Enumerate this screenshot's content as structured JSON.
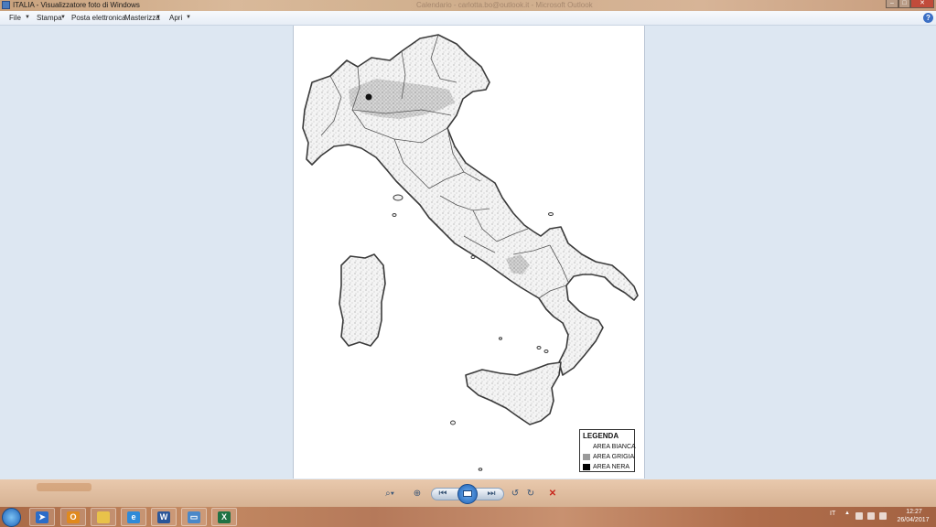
{
  "window": {
    "title": "ITALIA - Visualizzatore foto di Windows",
    "background_title": "Calendario - carlotta.bo@outlook.it - Microsoft Outlook"
  },
  "menu": {
    "items": [
      {
        "label": "File",
        "has_dropdown": true
      },
      {
        "label": "Stampa",
        "has_dropdown": true
      },
      {
        "label": "Posta elettronica",
        "has_dropdown": false
      },
      {
        "label": "Masterizza",
        "has_dropdown": true
      },
      {
        "label": "Apri",
        "has_dropdown": true
      }
    ],
    "help_label": "?"
  },
  "legend": {
    "title": "LEGENDA",
    "items": [
      {
        "label": "AREA BIANCA",
        "color": "#ffffff"
      },
      {
        "label": "AREA GRIGIA",
        "color": "#9a9a9a"
      },
      {
        "label": "AREA NERA",
        "color": "#000000"
      }
    ]
  },
  "controls": {
    "zoom_icon": "magnifier-icon",
    "fit_icon": "actual-size-icon",
    "prev_icon": "previous-icon",
    "slideshow_icon": "slideshow-icon",
    "next_icon": "next-icon",
    "rotate_left_icon": "rotate-ccw-icon",
    "rotate_right_icon": "rotate-cw-icon",
    "delete_icon": "delete-icon"
  },
  "taskbar": {
    "apps": [
      "start-orb",
      "outlook",
      "file-explorer",
      "internet-explorer",
      "word",
      "photo-viewer",
      "excel"
    ],
    "language": "IT",
    "time": "12:27",
    "date": "26/04/2017"
  },
  "colors": {
    "viewer_background": "#dde7f2",
    "map_outline": "#3a3a3a",
    "map_fill": "#ececec"
  }
}
